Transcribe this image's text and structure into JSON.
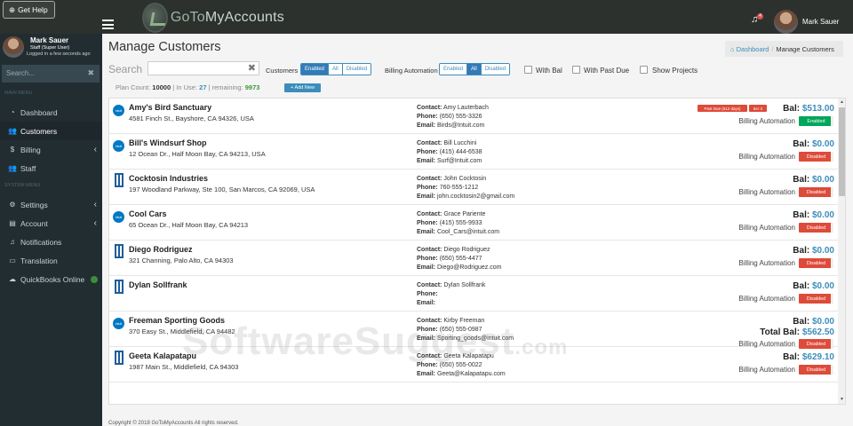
{
  "topbar": {
    "help_label": "Get Help",
    "logo_text_1": "GoTo",
    "logo_text_2": "MyAccounts",
    "notification_count": "4",
    "user_name": "Mark Sauer"
  },
  "sidebar": {
    "profile_name": "Mark Sauer",
    "profile_role": "Staff (Super User)",
    "profile_seen": "Logged in a few seconds ago",
    "search_placeholder": "Search...",
    "main_menu_label": "MAIN MENU",
    "system_menu_label": "SYSTEM MENU",
    "items": [
      {
        "label": "Dashboard",
        "icon": "dashboard-icon"
      },
      {
        "label": "Customers",
        "icon": "users-icon"
      },
      {
        "label": "Billing",
        "icon": "dollar-icon"
      },
      {
        "label": "Staff",
        "icon": "staff-icon"
      },
      {
        "label": "Settings",
        "icon": "gear-icon"
      },
      {
        "label": "Account",
        "icon": "account-icon"
      },
      {
        "label": "Notifications",
        "icon": "bell-icon"
      },
      {
        "label": "Translation",
        "icon": "translation-icon"
      },
      {
        "label": "QuickBooks Online",
        "icon": "cloud-icon"
      }
    ]
  },
  "page": {
    "title": "Manage Customers",
    "breadcrumb_home": "Dashboard",
    "breadcrumb_current": "Manage Customers"
  },
  "filters": {
    "search_label": "Search",
    "customers_label": "Customers",
    "customers_options": [
      "Enabled",
      "All",
      "Disabled"
    ],
    "customers_selected": "Enabled",
    "billing_label": "Billing Automation",
    "billing_options": [
      "Enabled",
      "All",
      "Disabled"
    ],
    "billing_selected": "All",
    "with_bal": "With Bal",
    "with_past_due": "With Past Due",
    "show_projects": "Show Projects"
  },
  "plan": {
    "count_label": "Plan Count:",
    "count": "10000",
    "sep1": "|",
    "in_use_label": "In Use:",
    "in_use": "27",
    "sep2": "|",
    "remaining_label": "remaining:",
    "remaining": "9973",
    "add_new": "+ Add New"
  },
  "customers": [
    {
      "name": "Amy's Bird Sanctuary",
      "address": "4581 Finch St., Bayshore, CA 94326, USA",
      "icon": "qb",
      "contact": "Amy Lauterbach",
      "phone": "(650) 555-3326",
      "email": "Birds@Intuit.com",
      "bal": "$513.00",
      "total_bal": "",
      "automation": "Enabled",
      "tags": [
        "Past Due (612 days)",
        "tier 3"
      ]
    },
    {
      "name": "Bill's Windsurf Shop",
      "address": "12 Ocean Dr., Half Moon Bay, CA 94213, USA",
      "icon": "qb",
      "contact": "Bill Lucchini",
      "phone": "(415) 444-6538",
      "email": "Surf@Intuit.com",
      "bal": "$0.00",
      "total_bal": "",
      "automation": "Disabled",
      "tags": []
    },
    {
      "name": "Cocktosin Industries",
      "address": "197 Woodland Parkway, Ste 100, San Marcos, CA 92069, USA",
      "icon": "building",
      "contact": "John Cocktosin",
      "phone": "760-555-1212",
      "email": "john.cocktosin2@gmail.com",
      "bal": "$0.00",
      "total_bal": "",
      "automation": "Disabled",
      "tags": []
    },
    {
      "name": "Cool Cars",
      "address": "65 Ocean Dr., Half Moon Bay, CA 94213",
      "icon": "qb",
      "contact": "Grace Pariente",
      "phone": "(415) 555-9933",
      "email": "Cool_Cars@intuit.com",
      "bal": "$0.00",
      "total_bal": "",
      "automation": "Disabled",
      "tags": []
    },
    {
      "name": "Diego Rodriguez",
      "address": "321 Channing, Palo Alto, CA 94303",
      "icon": "building",
      "contact": "Diego Rodriguez",
      "phone": "(650) 555-4477",
      "email": "Diego@Rodriguez.com",
      "bal": "$0.00",
      "total_bal": "",
      "automation": "Disabled",
      "tags": []
    },
    {
      "name": "Dylan Sollfrank",
      "address": "",
      "icon": "building",
      "contact": "Dylan Sollfrank",
      "phone": "",
      "email": "",
      "bal": "$0.00",
      "total_bal": "",
      "automation": "Disabled",
      "tags": []
    },
    {
      "name": "Freeman Sporting Goods",
      "address": "370 Easy St., Middlefield, CA 94482",
      "icon": "qb",
      "contact": "Kirby Freeman",
      "phone": "(650) 555-0987",
      "email": "Sporting_goods@intuit.com",
      "bal": "$0.00",
      "total_bal": "$562.50",
      "automation": "Disabled",
      "tags": []
    },
    {
      "name": "Geeta Kalapatapu",
      "address": "1987 Main St., Middlefield, CA 94303",
      "icon": "building",
      "contact": "Geeta Kalapatapu",
      "phone": "(650) 555-0022",
      "email": "Geeta@Kalapatapu.com",
      "bal": "$629.10",
      "total_bal": "",
      "automation": "Disabled",
      "tags": []
    }
  ],
  "labels": {
    "contact": "Contact:",
    "phone": "Phone:",
    "email": "Email:",
    "bal": "Bal:",
    "total_bal": "Total Bal:",
    "billing_automation": "Billing Automation",
    "qb_icon_text": "intuit"
  },
  "watermark": {
    "main": "SoftwareSuggest",
    "suffix": ".com"
  },
  "footer": "Copyright © 2018 GoToMyAccounts All rights reserved.",
  "colors": {
    "accent": "#3c8dbc",
    "sidebar": "#222d32",
    "topbar": "#2c312d",
    "danger": "#dd4b39",
    "success": "#00a65a"
  }
}
